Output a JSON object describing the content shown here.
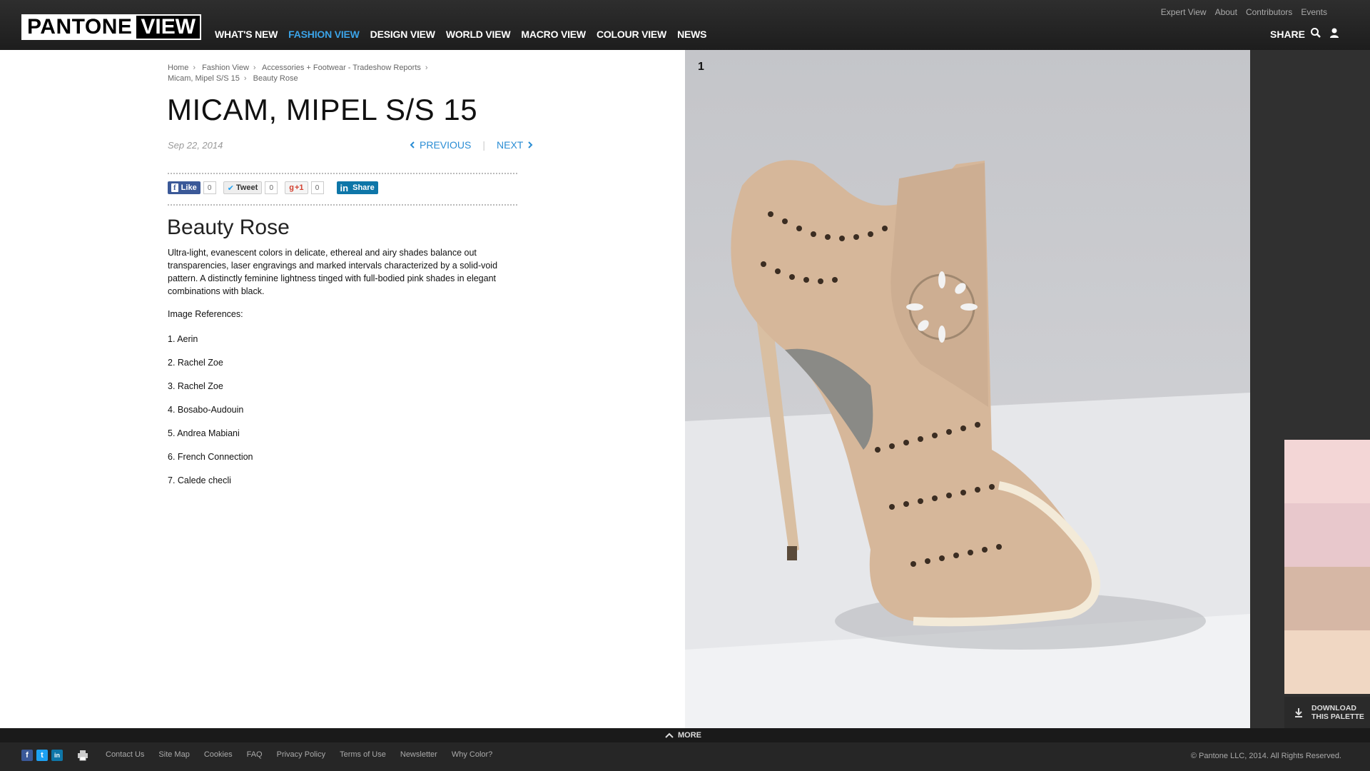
{
  "header": {
    "logo_left": "PANTONE",
    "logo_right": "VIEW",
    "top_links": [
      "Expert View",
      "About",
      "Contributors",
      "Events"
    ],
    "main_nav": [
      "WHAT'S NEW",
      "FASHION VIEW",
      "DESIGN VIEW",
      "WORLD VIEW",
      "MACRO VIEW",
      "COLOUR VIEW",
      "NEWS"
    ],
    "active_nav": "FASHION VIEW",
    "share_label": "SHARE",
    "icons": [
      "search-icon",
      "user-icon"
    ]
  },
  "breadcrumb": [
    "Home",
    "Fashion View",
    "Accessories + Footwear - Tradeshow Reports",
    "Micam, Mipel S/S 15",
    "Beauty Rose"
  ],
  "article": {
    "title": "MICAM, MIPEL S/S 15",
    "date": "Sep 22, 2014",
    "previous_label": "PREVIOUS",
    "next_label": "NEXT",
    "subtitle": "Beauty Rose",
    "body": "Ultra-light, evanescent colors in delicate, ethereal and airy shades balance out transparencies, laser engravings and marked intervals characterized by a solid-void pattern. A distinctly feminine lightness tinged with full-bodied pink shades in elegant combinations with black.",
    "refs_label": "Image References:",
    "refs": [
      "1. Aerin",
      "2. Rachel Zoe",
      "3. Rachel Zoe",
      "4. Bosabo-Audouin",
      "5. Andrea Mabiani",
      "6. French Connection",
      "7. Calede checli"
    ]
  },
  "social": {
    "like_label": "Like",
    "like_count": "0",
    "tweet_label": "Tweet",
    "tweet_count": "0",
    "gplus_label": "+1",
    "gplus_count": "0",
    "linkedin_label": "Share"
  },
  "gallery": {
    "image_number": "1",
    "subject": "laser-cut nude peep-toe bootie"
  },
  "palette": {
    "swatches": [
      "#f3d6d6",
      "#e8c8cc",
      "#d6b7a5",
      "#f0d7c3"
    ],
    "download_line1": "DOWNLOAD",
    "download_line2": "THIS PALETTE"
  },
  "footer": {
    "more_label": "MORE",
    "links": [
      "Contact Us",
      "Site Map",
      "Cookies",
      "FAQ",
      "Privacy Policy",
      "Terms of Use",
      "Newsletter",
      "Why Color?"
    ],
    "copyright": "© Pantone LLC, 2014. All Rights Reserved."
  },
  "colors": {
    "accent": "#3ba3e8",
    "link": "#2a8dd4",
    "header_bg": "#262626"
  }
}
